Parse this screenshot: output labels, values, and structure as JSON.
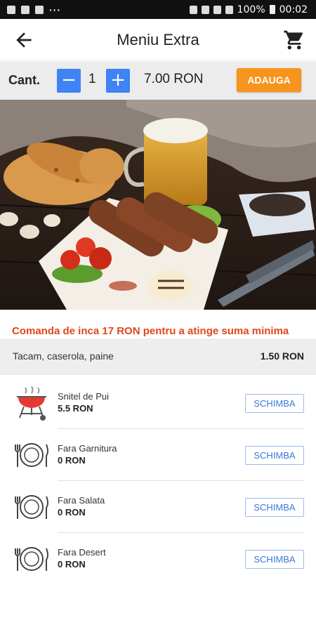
{
  "status": {
    "battery": "100%",
    "time": "00:02"
  },
  "header": {
    "title": "Meniu Extra",
    "back_icon": "arrow-back-icon",
    "cart_icon": "cart-icon"
  },
  "quantity": {
    "label": "Cant.",
    "minus": "−",
    "value": "1",
    "plus": "+",
    "price": "7.00 RON",
    "add_label": "ADAUGA"
  },
  "message": {
    "minimum": "Comanda de inca 17 RON pentru a atinge suma minima"
  },
  "extra": {
    "name": "Tacam, caserola, paine",
    "price": "1.50 RON"
  },
  "items": [
    {
      "name": "Snitel de Pui",
      "price": "5.5 RON",
      "button": "SCHIMBA",
      "icon": "grill-icon"
    },
    {
      "name": "Fara Garnitura",
      "price": "0 RON",
      "button": "SCHIMBA",
      "icon": "plate-cutlery-icon"
    },
    {
      "name": "Fara Salata",
      "price": "0 RON",
      "button": "SCHIMBA",
      "icon": "plate-cutlery-icon"
    },
    {
      "name": "Fara Desert",
      "price": "0 RON",
      "button": "SCHIMBA",
      "icon": "plate-cutlery-icon"
    }
  ],
  "colors": {
    "accent": "#3f83f5",
    "add_button": "#f7941d",
    "warning_text": "#e0461a"
  }
}
